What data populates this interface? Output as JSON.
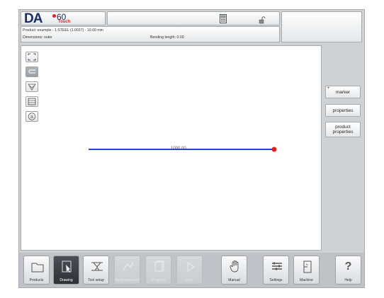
{
  "header": {
    "logo": {
      "brand": "DA",
      "model": "60",
      "edition": "Touch"
    },
    "calculator_icon": "calculator-icon",
    "lock_icon": "padlock-icon"
  },
  "info": {
    "product": "Product: example - 1 STEEL (1.0037) - 10.00 mm",
    "dimensions": "Dimensions: outer",
    "bending_length": "Bending length: 0.00"
  },
  "drawing": {
    "dimension_label": "1000.00",
    "line_color": "#2a3fd4",
    "endpoint_color": "#e02020"
  },
  "toolbar": {
    "tools": [
      "fit-view-icon",
      "bend-profile-icon",
      "shape-icon",
      "layer-icon",
      "annotation-icon"
    ]
  },
  "right_panel": {
    "marker_plus": "+",
    "marker": "marker",
    "properties": "properties",
    "product_properties_1": "product",
    "product_properties_2": "properties"
  },
  "bottom_nav": {
    "items": [
      {
        "label": "Products",
        "icon": "folder-icon"
      },
      {
        "label": "Drawing",
        "icon": "drawing-icon"
      },
      {
        "label": "Tool setup",
        "icon": "tool-setup-icon"
      },
      {
        "label": "Bend sequence",
        "icon": "bend-sequence-icon"
      },
      {
        "label": "Program",
        "icon": "program-icon"
      },
      {
        "label": "Auto",
        "icon": "play-icon"
      },
      {
        "label": "Manual",
        "icon": "hand-icon"
      },
      {
        "label": "Settings",
        "icon": "settings-icon"
      },
      {
        "label": "Machine",
        "icon": "machine-icon"
      },
      {
        "label": "Help",
        "icon": "help-icon",
        "glyph": "?"
      }
    ]
  }
}
